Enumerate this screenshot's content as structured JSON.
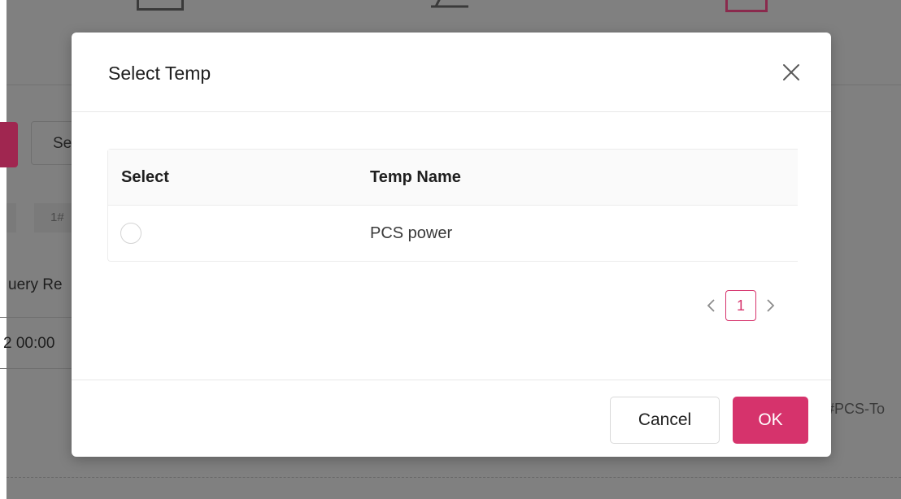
{
  "background": {
    "button_partial": "Se",
    "tag_partial": "1#",
    "query_partial": "uery Re",
    "date_partial": "2 00:00",
    "pcs_partial": "#PCS-To"
  },
  "modal": {
    "title": "Select Temp",
    "table": {
      "columns": [
        "Select",
        "Temp Name"
      ],
      "rows": [
        {
          "name": "PCS power",
          "selected": false
        }
      ]
    },
    "pagination": {
      "current_page": "1"
    },
    "footer": {
      "cancel_label": "Cancel",
      "ok_label": "OK"
    }
  },
  "colors": {
    "accent": "#d6336c",
    "overlay": "#808080"
  }
}
